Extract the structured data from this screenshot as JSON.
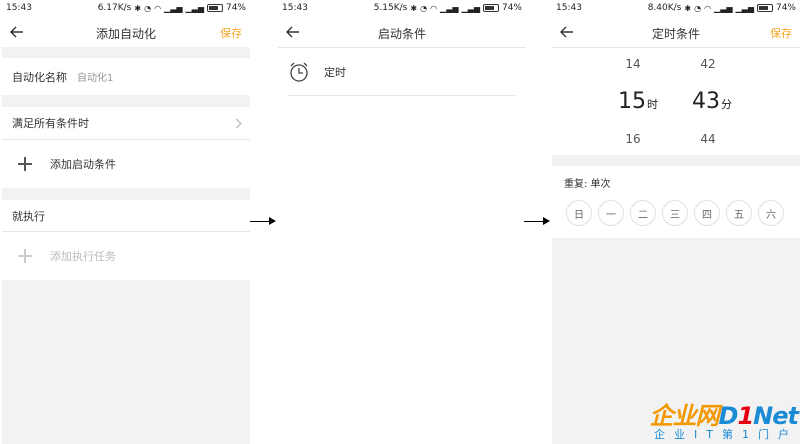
{
  "screen1": {
    "status": {
      "time": "15:43",
      "speed": "6.17K/s",
      "battery": "74%"
    },
    "title": "添加自动化",
    "save_label": "保存",
    "name_label": "自动化名称",
    "name_value": "自动化1",
    "conditions_label": "满足所有条件时",
    "add_condition_label": "添加启动条件",
    "execute_label": "就执行",
    "add_task_label": "添加执行任务"
  },
  "screen2": {
    "status": {
      "time": "15:43",
      "speed": "5.15K/s",
      "battery": "74%"
    },
    "title": "启动条件",
    "timer_label": "定时"
  },
  "screen3": {
    "status": {
      "time": "15:43",
      "speed": "8.40K/s",
      "battery": "74%"
    },
    "title": "定时条件",
    "save_label": "保存",
    "hour_prev": "14",
    "hour_selected": "15",
    "hour_unit": "时",
    "hour_next": "16",
    "minute_prev": "42",
    "minute_selected": "43",
    "minute_unit": "分",
    "minute_next": "44",
    "repeat_label": "重复: 单次",
    "days": [
      "日",
      "一",
      "二",
      "三",
      "四",
      "五",
      "六"
    ]
  },
  "watermark": {
    "top_part1": "企业网",
    "top_part2": "D",
    "top_part3": "1",
    "top_part4": "Net",
    "bottom": "企业IT第1门户"
  },
  "colors": {
    "accent": "#f5a623",
    "band_gray": "#f2f2f2",
    "watermark_orange": "#f39800",
    "watermark_blue": "#1a8bd4"
  }
}
